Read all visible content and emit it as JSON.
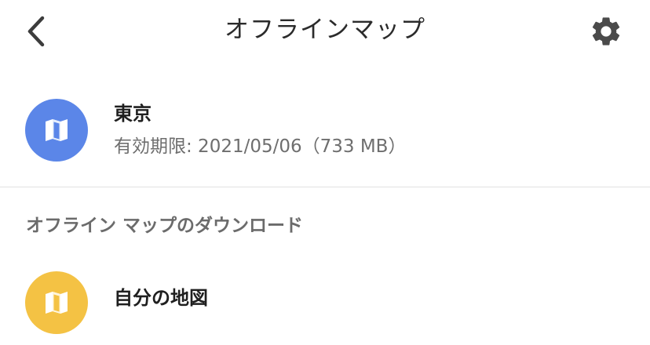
{
  "header": {
    "title": "オフラインマップ",
    "back_icon": "chevron-left-icon",
    "settings_icon": "gear-icon"
  },
  "downloaded_map": {
    "name": "東京",
    "detail": "有効期限: 2021/05/06（733 MB）",
    "icon": "map-icon",
    "icon_color": "#5b86e8"
  },
  "download_section": {
    "heading": "オフライン マップのダウンロード",
    "items": [
      {
        "label": "自分の地図",
        "icon": "map-icon",
        "icon_color": "#f4c244"
      }
    ]
  },
  "colors": {
    "background": "#ffffff",
    "divider": "#e2e2e2",
    "icon_dark": "#3c3c3c"
  }
}
